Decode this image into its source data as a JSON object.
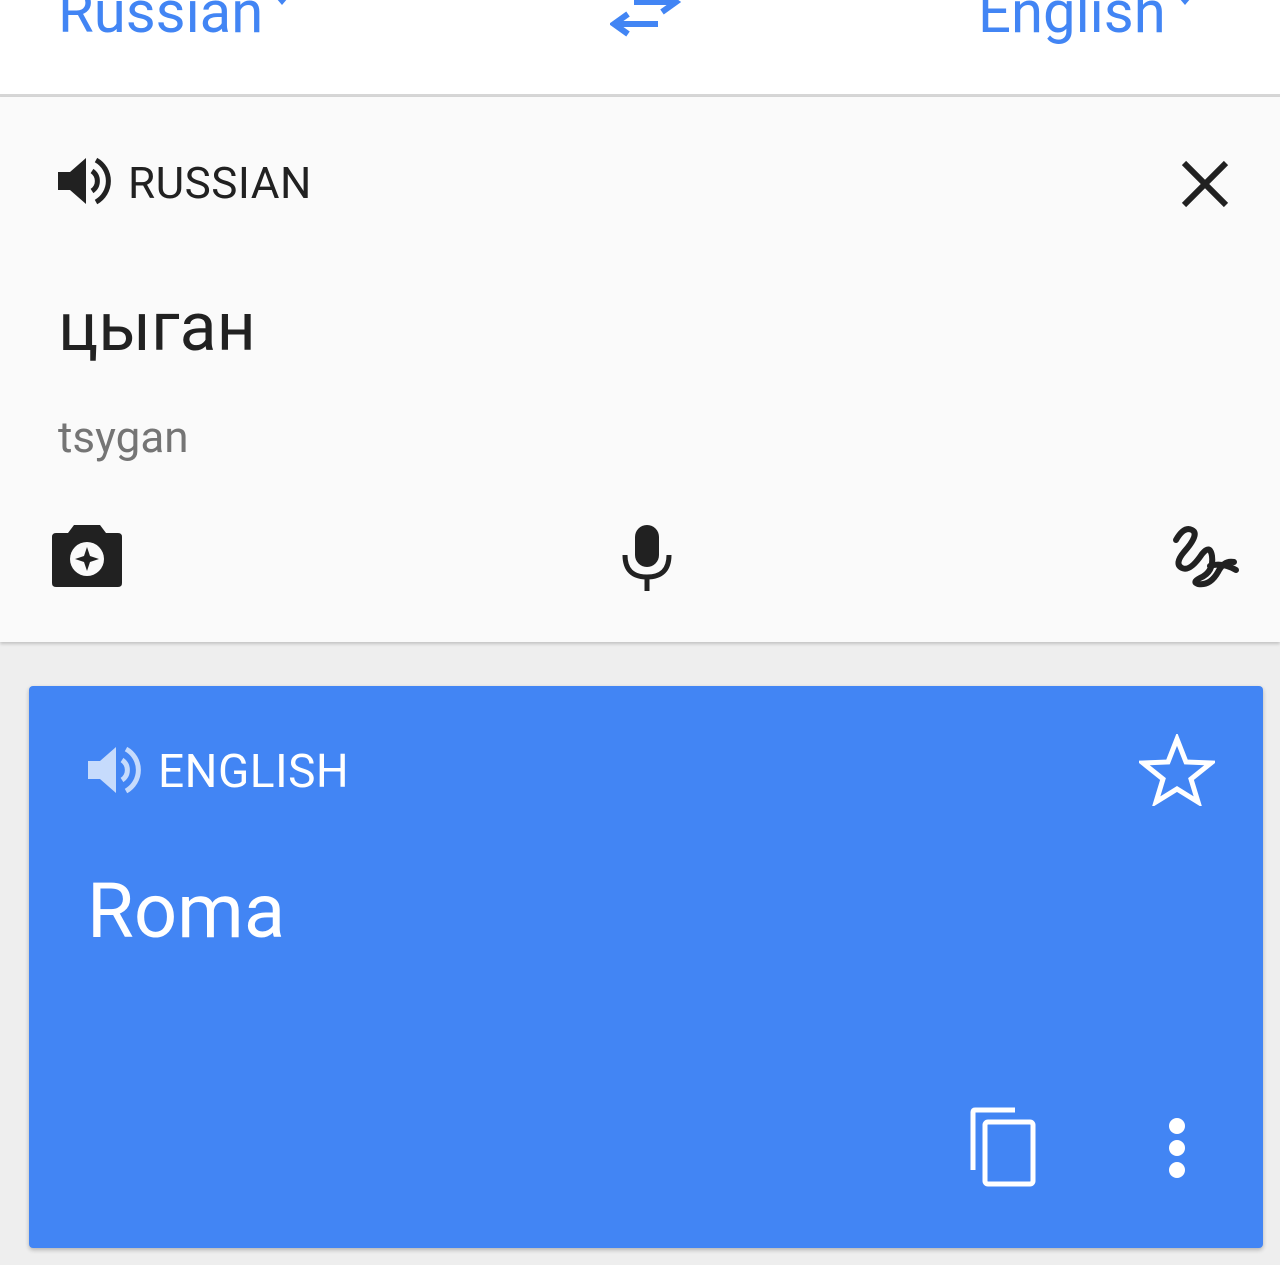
{
  "lang_bar": {
    "source_language": "Russian",
    "target_language": "English",
    "swap_icon": "swap-arrows-icon"
  },
  "input_card": {
    "speaker_icon": "speaker-icon",
    "language_label": "RUSSIAN",
    "close_icon": "close-icon",
    "source_text": "цыган",
    "transliteration": "tsygan",
    "tools": [
      "camera-icon",
      "mic-icon",
      "handwriting-icon"
    ]
  },
  "result_card": {
    "speaker_icon": "speaker-icon",
    "language_label": "ENGLISH",
    "star_icon": "star-outline-icon",
    "translation": "Roma",
    "copy_icon": "copy-icon",
    "more_icon": "more-vert-icon"
  },
  "colors": {
    "accent": "#4285f4",
    "result_bg": "#4285f4",
    "text_primary": "#212121",
    "text_secondary": "#757575"
  }
}
